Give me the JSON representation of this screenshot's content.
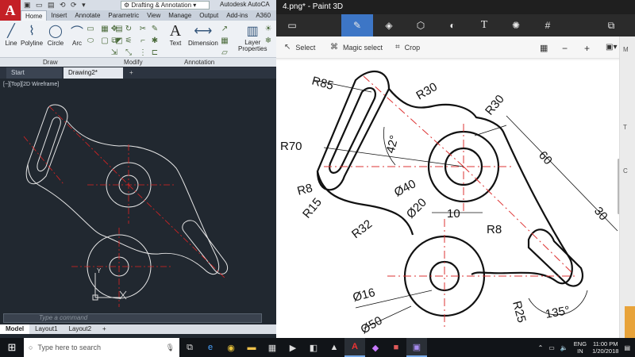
{
  "autocad": {
    "app_title": "Autodesk AutoCA",
    "workspace": "Drafting & Annotation",
    "logo": "A",
    "ribbon_tabs": [
      "Home",
      "Insert",
      "Annotate",
      "Parametric",
      "View",
      "Manage",
      "Output",
      "Add-ins",
      "A360",
      "Fe"
    ],
    "draw_tools": [
      "Line",
      "Polyline",
      "Circle",
      "Arc"
    ],
    "text_tool": "Text",
    "dimension_tool": "Dimension",
    "layer_tool": "Layer\nProperties",
    "panel_labels": [
      "Draw",
      "Modify",
      "Annotation"
    ],
    "file_tabs": [
      "Start",
      "Drawing2*"
    ],
    "view_label": "[−][Top][2D Wireframe]",
    "command_placeholder": "Type a command",
    "layout_tabs": [
      "Model",
      "Layout1",
      "Layout2"
    ],
    "ucs_label": "Y"
  },
  "paint3d": {
    "window_title": "4.png* - Paint 3D",
    "tools": [
      "folder-icon",
      "brush-icon",
      "2d-shapes-icon",
      "3d-shapes-icon",
      "stickers-icon",
      "text-icon",
      "effects-icon",
      "canvas-icon",
      "paste-icon"
    ],
    "sub_buttons": [
      "Select",
      "Magic select",
      "Crop"
    ],
    "drawing_labels": {
      "r85": "R85",
      "r30_top": "R30",
      "r30_right": "R30",
      "r70": "R70",
      "angle42": "42°",
      "dim60": "60",
      "r8_left": "R8",
      "dia40": "Ø40",
      "r15": "R15",
      "dia20": "Ø20",
      "dim10": "10",
      "dim30": "30",
      "r32": "R32",
      "r8_right": "R8",
      "dia16": "Ø16",
      "r25": "R25",
      "dia50": "Ø50",
      "angle135": "135°"
    }
  },
  "taskbar": {
    "search_placeholder": "Type here to search",
    "language": "ENG",
    "region": "IN",
    "time": "11:00 PM",
    "date": "1/20/2018"
  }
}
